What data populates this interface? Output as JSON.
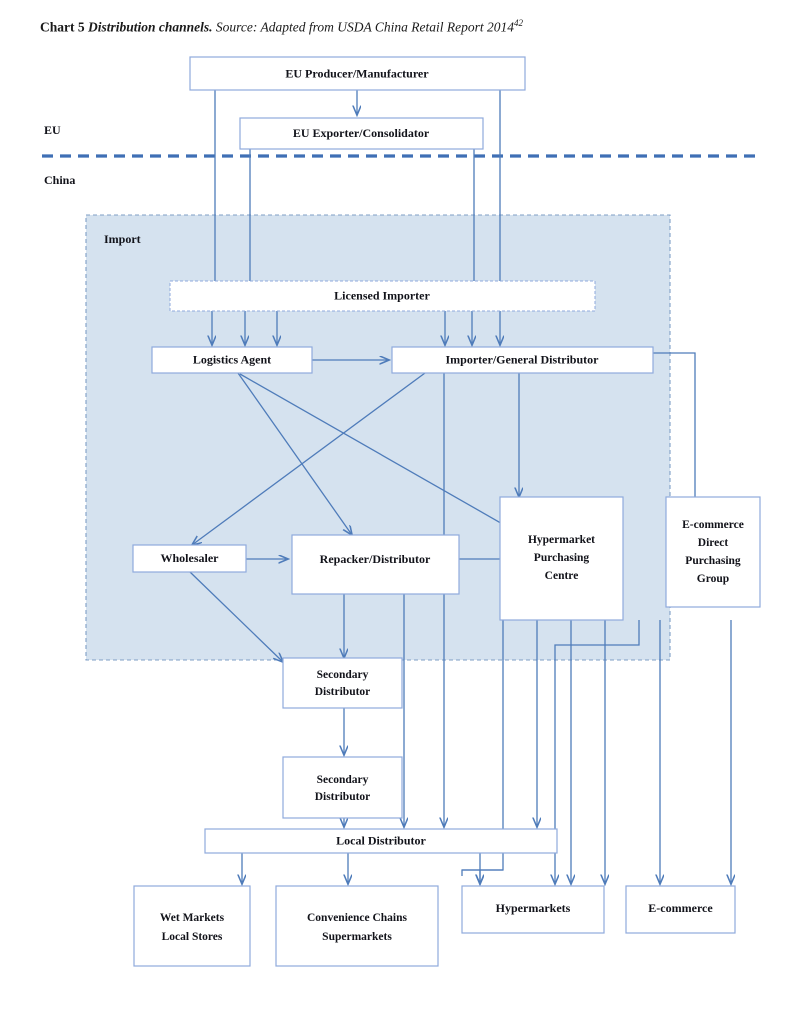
{
  "caption": {
    "lead": "Chart 5 ",
    "title": "Distribution channels.",
    "source": " Source: Adapted from USDA China Retail Report 2014",
    "footnote": "42"
  },
  "region_labels": {
    "eu": "EU",
    "china": "China"
  },
  "panel": {
    "label": "Import",
    "fill": "#d5e2ef",
    "stroke": "#7f9fc6"
  },
  "colors": {
    "line": "#4f7cba",
    "box_stroke": "#8faadc",
    "divider": "#3f6fb5",
    "box_fill": "#ffffff"
  },
  "nodes": {
    "eu_producer": "EU Producer/Manufacturer",
    "eu_exporter": "EU Exporter/Consolidator",
    "licensed_importer": "Licensed Importer",
    "logistics_agent": "Logistics Agent",
    "importer_general_distributor": "Importer/General Distributor",
    "wholesaler": "Wholesaler",
    "repacker_distributor": "Repacker/Distributor",
    "hypermarket_purchasing_centre_l1": "Hypermarket",
    "hypermarket_purchasing_centre_l2": "Purchasing",
    "hypermarket_purchasing_centre_l3": "Centre",
    "ecommerce_group_l1": "E-commerce",
    "ecommerce_group_l2": "Direct",
    "ecommerce_group_l3": "Purchasing",
    "ecommerce_group_l4": "Group",
    "secondary_distributor_1_l1": "Secondary",
    "secondary_distributor_1_l2": "Distributor",
    "secondary_distributor_2_l1": "Secondary",
    "secondary_distributor_2_l2": "Distributor",
    "local_distributor": "Local Distributor",
    "wet_markets_l1": "Wet Markets",
    "wet_markets_l2": "Local Stores",
    "convenience_l1": "Convenience Chains",
    "convenience_l2": "Supermarkets",
    "hypermarkets": "Hypermarkets",
    "ecommerce": "E-commerce"
  },
  "chart_data": {
    "type": "diagram",
    "title": "Distribution channels",
    "flows": [
      {
        "from": "EU Producer/Manufacturer",
        "to": "EU Exporter/Consolidator"
      },
      {
        "from": "EU Producer/Manufacturer",
        "to": "Licensed Importer"
      },
      {
        "from": "EU Exporter/Consolidator",
        "to": "Licensed Importer"
      },
      {
        "from": "Licensed Importer",
        "to": "Logistics Agent"
      },
      {
        "from": "Licensed Importer",
        "to": "Importer/General Distributor"
      },
      {
        "from": "Logistics Agent",
        "to": "Importer/General Distributor"
      },
      {
        "from": "Logistics Agent",
        "to": "Repacker/Distributor"
      },
      {
        "from": "Logistics Agent",
        "to": "Hypermarket Purchasing Centre"
      },
      {
        "from": "Importer/General Distributor",
        "to": "Wholesaler"
      },
      {
        "from": "Importer/General Distributor",
        "to": "Hypermarket Purchasing Centre"
      },
      {
        "from": "Importer/General Distributor",
        "to": "Secondary Distributor"
      },
      {
        "from": "Importer/General Distributor",
        "to": "Local Distributor"
      },
      {
        "from": "Importer/General Distributor",
        "to": "E-commerce Direct Purchasing Group"
      },
      {
        "from": "Wholesaler",
        "to": "Repacker/Distributor"
      },
      {
        "from": "Wholesaler",
        "to": "Secondary Distributor"
      },
      {
        "from": "Repacker/Distributor",
        "to": "Hypermarket Purchasing Centre"
      },
      {
        "from": "Repacker/Distributor",
        "to": "Secondary Distributor"
      },
      {
        "from": "Repacker/Distributor",
        "to": "Local Distributor"
      },
      {
        "from": "Hypermarket Purchasing Centre",
        "to": "Local Distributor"
      },
      {
        "from": "Hypermarket Purchasing Centre",
        "to": "Hypermarkets"
      },
      {
        "from": "E-commerce Direct Purchasing Group",
        "to": "E-commerce"
      },
      {
        "from": "Secondary Distributor",
        "to": "Secondary Distributor"
      },
      {
        "from": "Secondary Distributor",
        "to": "Local Distributor"
      },
      {
        "from": "Local Distributor",
        "to": "Wet Markets Local Stores"
      },
      {
        "from": "Local Distributor",
        "to": "Convenience Chains Supermarkets"
      },
      {
        "from": "Local Distributor",
        "to": "Hypermarkets"
      }
    ]
  }
}
